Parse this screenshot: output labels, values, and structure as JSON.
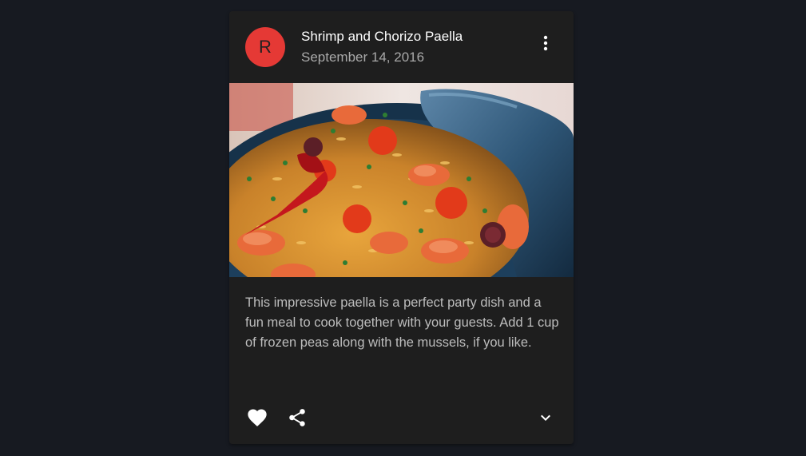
{
  "card": {
    "avatar_letter": "R",
    "avatar_color": "#e53935",
    "title": "Shrimp and Chorizo Paella",
    "subheader": "September 14, 2016",
    "menu_icon": "more-vert-icon",
    "image_alt": "Paella dish",
    "description": "This impressive paella is a perfect party dish and a fun meal to cook together with your guests. Add 1 cup of frozen peas along with the mussels, if you like."
  },
  "actions": {
    "favorite_icon": "heart-icon",
    "share_icon": "share-icon",
    "expand_icon": "chevron-down-icon"
  }
}
